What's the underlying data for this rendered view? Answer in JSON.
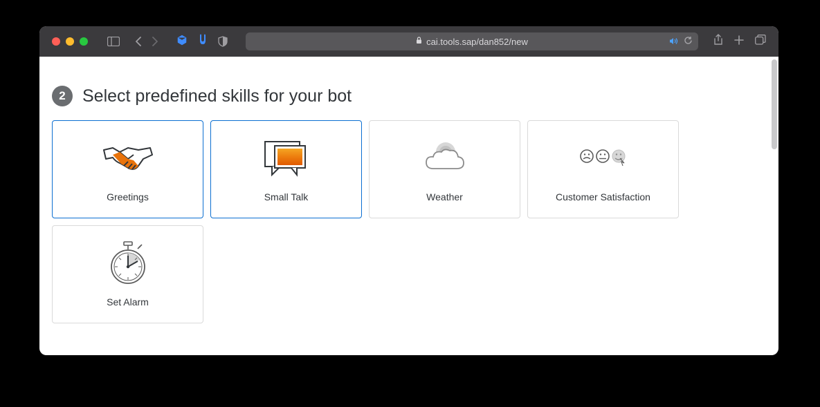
{
  "browser": {
    "url": "cai.tools.sap/dan852/new"
  },
  "step": {
    "number": "2",
    "title": "Select predefined skills for your bot"
  },
  "skills": [
    {
      "label": "Greetings",
      "selected": true
    },
    {
      "label": "Small Talk",
      "selected": true
    },
    {
      "label": "Weather",
      "selected": false
    },
    {
      "label": "Customer Satisfaction",
      "selected": false
    },
    {
      "label": "Set Alarm",
      "selected": false
    }
  ]
}
